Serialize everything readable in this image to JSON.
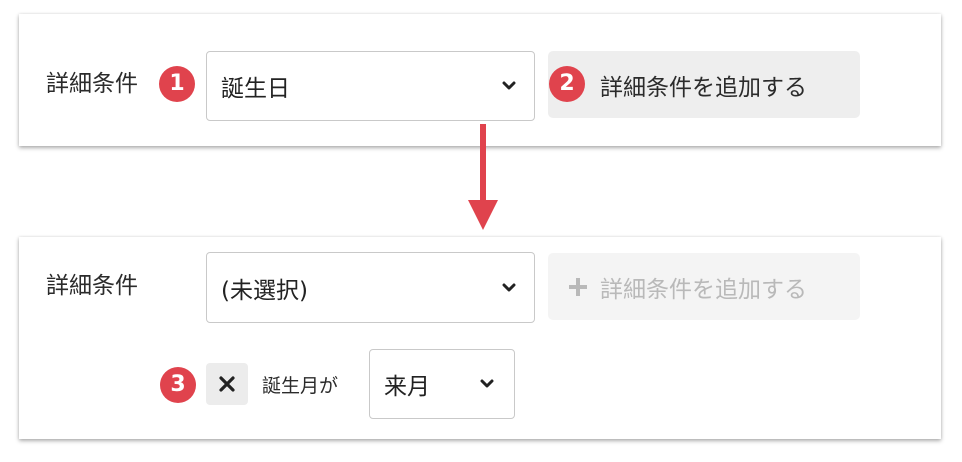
{
  "top_panel": {
    "label": "詳細条件",
    "badge": "1",
    "select": {
      "value": "誕生日",
      "icon": "chevron-down-icon"
    },
    "add_badge": "2",
    "add_button": {
      "label": "詳細条件を追加する",
      "state": "enabled"
    }
  },
  "arrow": {
    "icon": "arrow-down-icon",
    "color": "#e0434d"
  },
  "bottom_panel": {
    "label": "詳細条件",
    "select": {
      "value": "(未選択)",
      "icon": "chevron-down-icon"
    },
    "add_button": {
      "icon": "plus-icon",
      "label": "詳細条件を追加する",
      "state": "disabled"
    },
    "condition": {
      "badge": "3",
      "remove_icon": "close-icon",
      "field_label": "誕生月が",
      "select": {
        "value": "来月",
        "icon": "chevron-down-icon"
      }
    }
  },
  "colors": {
    "accent": "#e0434d",
    "button_bg": "#eeeeee",
    "disabled_text": "#b9b9b9"
  }
}
